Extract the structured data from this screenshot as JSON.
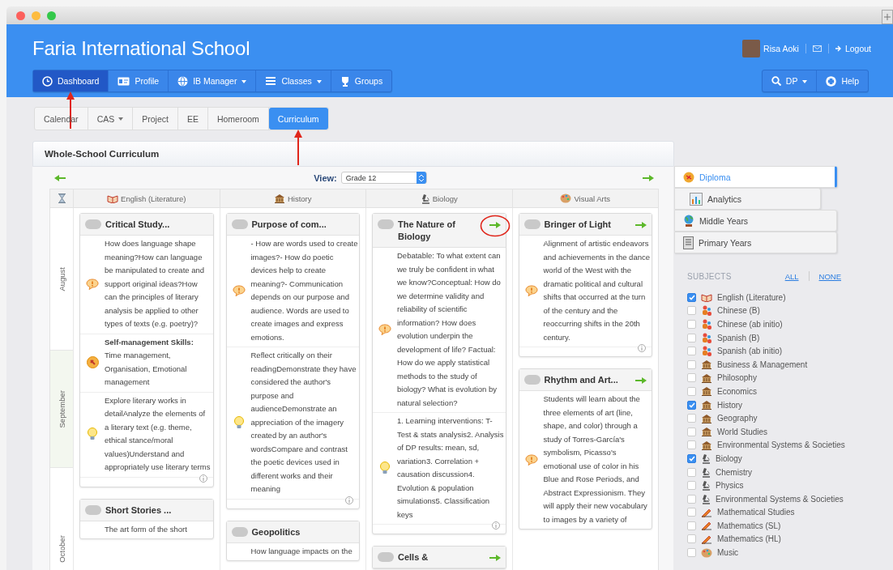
{
  "header": {
    "school": "Faria International School",
    "nav": [
      {
        "label": "Dashboard",
        "selected": true,
        "has_menu": false,
        "annotated": true
      },
      {
        "label": "Profile",
        "selected": false,
        "has_menu": false,
        "annotated": false
      },
      {
        "label": "IB Manager",
        "selected": false,
        "has_menu": true,
        "annotated": false
      },
      {
        "label": "Classes",
        "selected": false,
        "has_menu": true,
        "annotated": false
      },
      {
        "label": "Groups",
        "selected": false,
        "has_menu": false,
        "annotated": false
      }
    ],
    "user": "Risa Aoki",
    "logout": "Logout",
    "tools": [
      {
        "label": "DP",
        "has_menu": true
      },
      {
        "label": "Help",
        "has_menu": false
      }
    ]
  },
  "tabs": [
    {
      "label": "Calendar",
      "selected": false,
      "has_menu": false,
      "annotated": false
    },
    {
      "label": "CAS",
      "selected": false,
      "has_menu": true,
      "annotated": false
    },
    {
      "label": "Project",
      "selected": false,
      "has_menu": false,
      "annotated": false
    },
    {
      "label": "EE",
      "selected": false,
      "has_menu": false,
      "annotated": false
    },
    {
      "label": "Homeroom",
      "selected": false,
      "has_menu": false,
      "annotated": false
    },
    {
      "label": "Curriculum",
      "selected": true,
      "has_menu": false,
      "annotated": true
    }
  ],
  "panel": {
    "title": "Whole-School Curriculum",
    "view_label": "View:",
    "view_value": "Grade 12",
    "months": [
      "August",
      "September",
      "October"
    ],
    "columns": [
      {
        "name": "English (Literature)",
        "cards": [
          {
            "title": "Critical Study...",
            "linked": false,
            "annotated": false,
            "info": true,
            "sections": [
              {
                "kind": "question",
                "text": "How does language shape meaning?How can language be manipulated to create and support original ideas?How can the principles of literary analysis be applied to other types of texts (e.g. poetry)?"
              },
              {
                "kind": "skills",
                "text": "**Self-management Skills:** Time management, Organisation, Emotional management"
              },
              {
                "kind": "objective",
                "text": "Explore literary works in detailAnalyze the elements of a literary text (e.g. theme, ethical stance/moral values)Understand and appropriately use literary terms"
              }
            ]
          },
          {
            "title": "Short Stories ...",
            "linked": false,
            "annotated": false,
            "info": false,
            "sections": [
              {
                "kind": "plain",
                "text": "The art form of the short"
              }
            ]
          }
        ]
      },
      {
        "name": "History",
        "cards": [
          {
            "title": "Purpose of com...",
            "linked": false,
            "annotated": false,
            "info": true,
            "sections": [
              {
                "kind": "question",
                "text": "- How are words used to create images?- How do poetic devices help to create meaning?- Communication depends on our purpose and audience. Words are used to create images and express emotions."
              },
              {
                "kind": "objective",
                "text": "Reflect critically on their readingDemonstrate they have considered the author's purpose and audienceDemonstrate an appreciation of the imagery created by an author's wordsCompare and contrast the poetic devices used in different works and their meaning"
              }
            ]
          },
          {
            "title": "Geopolitics",
            "linked": false,
            "annotated": false,
            "info": false,
            "sections": [
              {
                "kind": "plain",
                "text": "How language impacts on the"
              }
            ]
          }
        ]
      },
      {
        "name": "Biology",
        "cards": [
          {
            "title": "The Nature of Biology",
            "linked": true,
            "annotated": true,
            "info": true,
            "sections": [
              {
                "kind": "question",
                "text": "Debatable: To what extent can we truly be confident in what we know?Conceptual: How do we determine validity and reliability of scientific information? How does evolution underpin the development of life? Factual: How do we apply statistical methods to the study of biology? What is evolution by natural selection?"
              },
              {
                "kind": "objective",
                "text": "1. Learning interventions: T-Test & stats analysis2. Analysis of DP results: mean, sd, variation3. Correlation + causation discussion4. Evolution & population simulations5. Classification keys"
              }
            ]
          },
          {
            "title": "Cells &",
            "linked": true,
            "annotated": false,
            "info": false
          }
        ]
      },
      {
        "name": "Visual Arts",
        "cards": [
          {
            "title": "Bringer of Light",
            "linked": true,
            "annotated": false,
            "info": true,
            "sections": [
              {
                "kind": "question",
                "text": "Alignment of artistic endeavors and achievements in the dance world of the West with the dramatic political and cultural shifts that occurred at the turn of the century and the reoccurring shifts in the 20th century."
              }
            ]
          },
          {
            "title": "Rhythm and Art...",
            "linked": true,
            "annotated": false,
            "info": false,
            "sections": [
              {
                "kind": "question",
                "text": "Students will learn about the three elements of art (line, shape, and color) through a study of Torres-García's symbolism, Picasso's emotional use of color in his Blue and Rose Periods, and Abstract Expressionism. They will apply their new vocabulary to images by a variety of"
              }
            ]
          }
        ]
      }
    ]
  },
  "sidebar": {
    "programmes": [
      {
        "label": "Diploma",
        "kind": "main",
        "selected": true
      },
      {
        "label": "Analytics",
        "kind": "sub",
        "selected": false
      },
      {
        "label": "Middle Years",
        "kind": "main",
        "selected": false
      },
      {
        "label": "Primary Years",
        "kind": "main",
        "selected": false
      }
    ],
    "subjects_title": "SUBJECTS",
    "all": "ALL",
    "none": "NONE",
    "subjects": [
      {
        "name": "English (Literature)",
        "checked": true
      },
      {
        "name": "Chinese (B)",
        "checked": false
      },
      {
        "name": "Chinese (ab initio)",
        "checked": false
      },
      {
        "name": "Spanish (B)",
        "checked": false
      },
      {
        "name": "Spanish (ab initio)",
        "checked": false
      },
      {
        "name": "Business & Management",
        "checked": false
      },
      {
        "name": "Philosophy",
        "checked": false
      },
      {
        "name": "Economics",
        "checked": false
      },
      {
        "name": "History",
        "checked": true
      },
      {
        "name": "Geography",
        "checked": false
      },
      {
        "name": "World Studies",
        "checked": false
      },
      {
        "name": "Environmental Systems & Societies",
        "checked": false
      },
      {
        "name": "Biology",
        "checked": true
      },
      {
        "name": "Chemistry",
        "checked": false
      },
      {
        "name": "Physics",
        "checked": false
      },
      {
        "name": "Environmental Systems & Societies",
        "checked": false
      },
      {
        "name": "Mathematical Studies",
        "checked": false
      },
      {
        "name": "Mathematics (SL)",
        "checked": false
      },
      {
        "name": "Mathematics (HL)",
        "checked": false
      },
      {
        "name": "Music",
        "checked": false
      }
    ]
  }
}
